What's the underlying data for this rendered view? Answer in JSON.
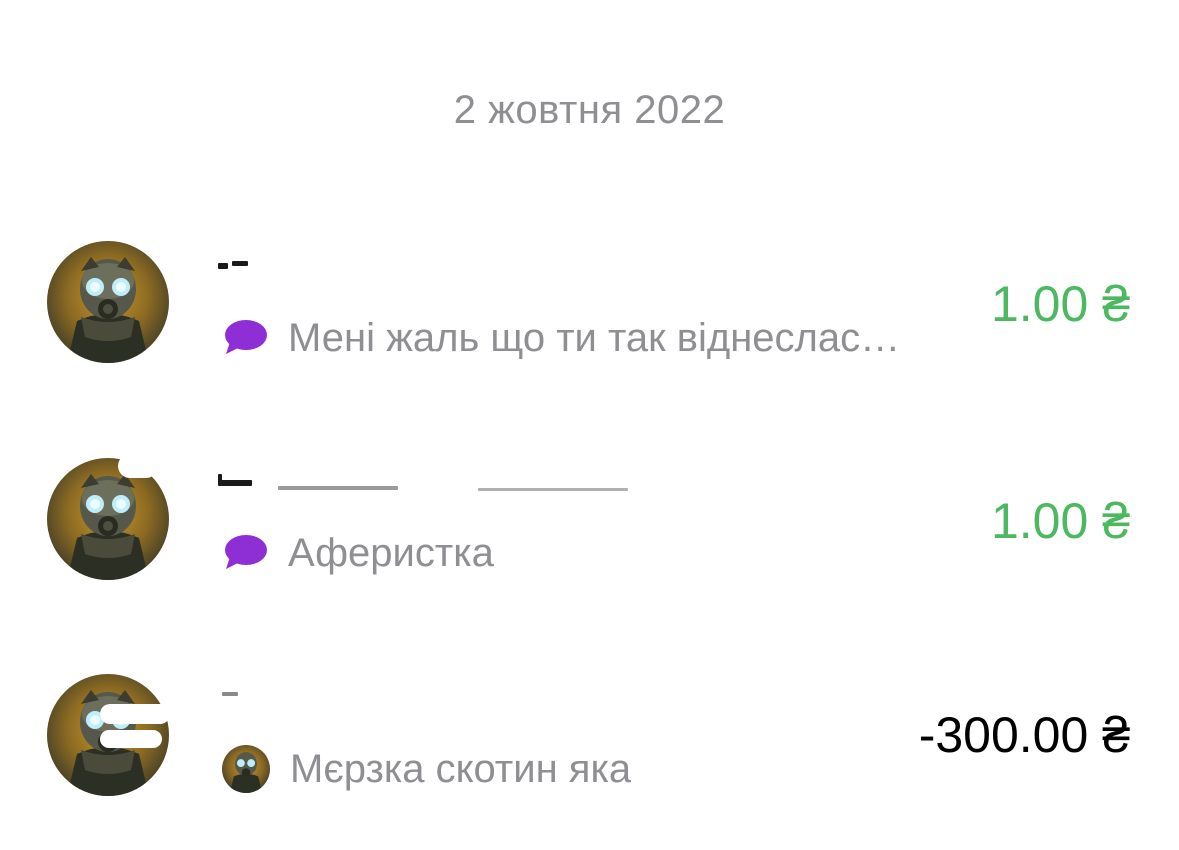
{
  "date_header": "2 жовтня 2022",
  "colors": {
    "positive": "#4cb85f",
    "negative": "#000000",
    "secondary_text": "#8e8e93",
    "comment_bubble": "#8e2fd6"
  },
  "transactions": [
    {
      "avatar_icon": "gas-mask-avatar-icon",
      "message_icon": "chat-bubble-icon",
      "message": "Мені жаль що ти так віднеслас…",
      "amount": "1.00 ₴",
      "direction": "incoming"
    },
    {
      "avatar_icon": "gas-mask-avatar-icon",
      "message_icon": "chat-bubble-icon",
      "message": "Аферистка",
      "amount": "1.00 ₴",
      "direction": "incoming"
    },
    {
      "avatar_icon": "gas-mask-avatar-icon",
      "message_icon": "gas-mask-mini-avatar-icon",
      "message": "Мєрзка скотин яка",
      "amount": "-300.00 ₴",
      "direction": "outgoing"
    }
  ]
}
